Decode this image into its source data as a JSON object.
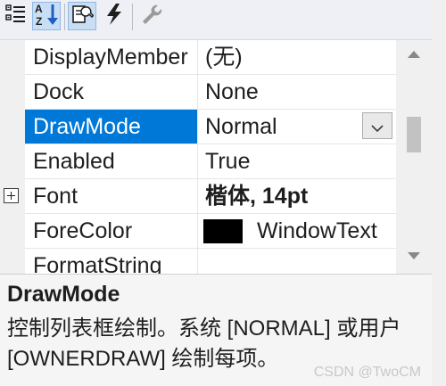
{
  "toolbar": {
    "buttons": [
      {
        "icon": "categorized-icon",
        "active": false
      },
      {
        "icon": "alphabetical-sort-icon",
        "label": "AZ",
        "active": true
      },
      {
        "icon": "properties-icon",
        "active": true
      },
      {
        "icon": "events-lightning-icon",
        "active": false
      },
      {
        "icon": "property-pages-wrench-icon",
        "active": false
      }
    ]
  },
  "grid": {
    "rows": [
      {
        "name": "DisplayMember",
        "value": "(无)"
      },
      {
        "name": "Dock",
        "value": "None"
      },
      {
        "name": "DrawMode",
        "value": "Normal",
        "selected": true,
        "dropdown": true
      },
      {
        "name": "Enabled",
        "value": "True"
      },
      {
        "name": "Font",
        "value": "楷体, 14pt",
        "expandable": true,
        "bold_value": true
      },
      {
        "name": "ForeColor",
        "value": "WindowText",
        "color_swatch": "#000000"
      },
      {
        "name": "FormatString",
        "value": ""
      }
    ]
  },
  "description": {
    "title": "DrawMode",
    "text": "控制列表框绘制。系统 [NORMAL] 或用户 [OWNERDRAW] 绘制每项。"
  },
  "watermark": "CSDN @TwoCM",
  "colors": {
    "selection": "#0078d7",
    "toolbar_active": "#c9def5"
  }
}
